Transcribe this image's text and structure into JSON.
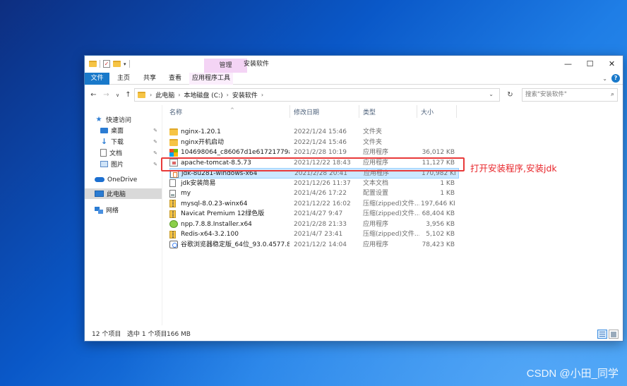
{
  "window": {
    "title": "安装软件",
    "context_tab": "管理",
    "controls": {
      "minimize": "—",
      "maximize": "☐",
      "close": "✕"
    }
  },
  "ribbon": {
    "tabs": [
      "文件",
      "主页",
      "共享",
      "查看",
      "应用程序工具"
    ]
  },
  "address": {
    "crumbs": [
      "此电脑",
      "本地磁盘 (C:)",
      "安装软件"
    ],
    "search_placeholder": "搜索\"安装软件\""
  },
  "nav_pane": {
    "items": [
      {
        "label": "快速访问",
        "icon": "star-icon"
      },
      {
        "label": "桌面",
        "icon": "desktop-icon",
        "pinned": true
      },
      {
        "label": "下载",
        "icon": "download-icon",
        "pinned": true
      },
      {
        "label": "文档",
        "icon": "document-icon",
        "pinned": true
      },
      {
        "label": "图片",
        "icon": "picture-icon",
        "pinned": true
      },
      {
        "label": "OneDrive",
        "icon": "cloud-icon"
      },
      {
        "label": "此电脑",
        "icon": "computer-icon",
        "selected": true
      },
      {
        "label": "网络",
        "icon": "network-icon"
      }
    ]
  },
  "columns": {
    "name": "名称",
    "date": "修改日期",
    "type": "类型",
    "size": "大小"
  },
  "files": [
    {
      "name": "nginx-1.20.1",
      "date": "2022/1/24 15:46",
      "type": "文件夹",
      "size": "",
      "icon": "folder"
    },
    {
      "name": "nginx开机启动",
      "date": "2022/1/24 15:46",
      "type": "文件夹",
      "size": "",
      "icon": "folder"
    },
    {
      "name": "104698064_c86067d1e61721779a234...",
      "date": "2021/2/28 10:19",
      "type": "应用程序",
      "size": "36,012 KB",
      "icon": "ms"
    },
    {
      "name": "apache-tomcat-8.5.73",
      "date": "2021/12/22 18:43",
      "type": "应用程序",
      "size": "11,127 KB",
      "icon": "exe"
    },
    {
      "name": "jdk-8u281-windows-x64",
      "date": "2021/2/28 20:41",
      "type": "应用程序",
      "size": "170,982 KB",
      "icon": "java",
      "selected": true
    },
    {
      "name": "jdk安装简易",
      "date": "2021/12/26 11:37",
      "type": "文本文档",
      "size": "1 KB",
      "icon": "txt"
    },
    {
      "name": "my",
      "date": "2021/4/26 17:22",
      "type": "配置设置",
      "size": "1 KB",
      "icon": "ini"
    },
    {
      "name": "mysql-8.0.23-winx64",
      "date": "2021/12/22 16:02",
      "type": "压缩(zipped)文件...",
      "size": "197,646 KB",
      "icon": "zip"
    },
    {
      "name": "Navicat Premium 12绿色版",
      "date": "2021/4/27 9:47",
      "type": "压缩(zipped)文件...",
      "size": "68,404 KB",
      "icon": "zip"
    },
    {
      "name": "npp.7.8.8.Installer.x64",
      "date": "2021/2/28 21:33",
      "type": "应用程序",
      "size": "3,956 KB",
      "icon": "npp"
    },
    {
      "name": "Redis-x64-3.2.100",
      "date": "2021/4/7 23:41",
      "type": "压缩(zipped)文件...",
      "size": "5,102 KB",
      "icon": "zip"
    },
    {
      "name": "谷歌浏览器稳定版_64位_93.0.4577.82",
      "date": "2021/12/2 14:04",
      "type": "应用程序",
      "size": "78,423 KB",
      "icon": "chrome"
    }
  ],
  "status": {
    "count": "12 个项目",
    "selected": "选中 1 个项目",
    "size": "166 MB"
  },
  "annotation": {
    "text": "打开安装程序,安装jdk",
    "color": "#e8262b"
  },
  "watermark": "CSDN @小田_同学"
}
